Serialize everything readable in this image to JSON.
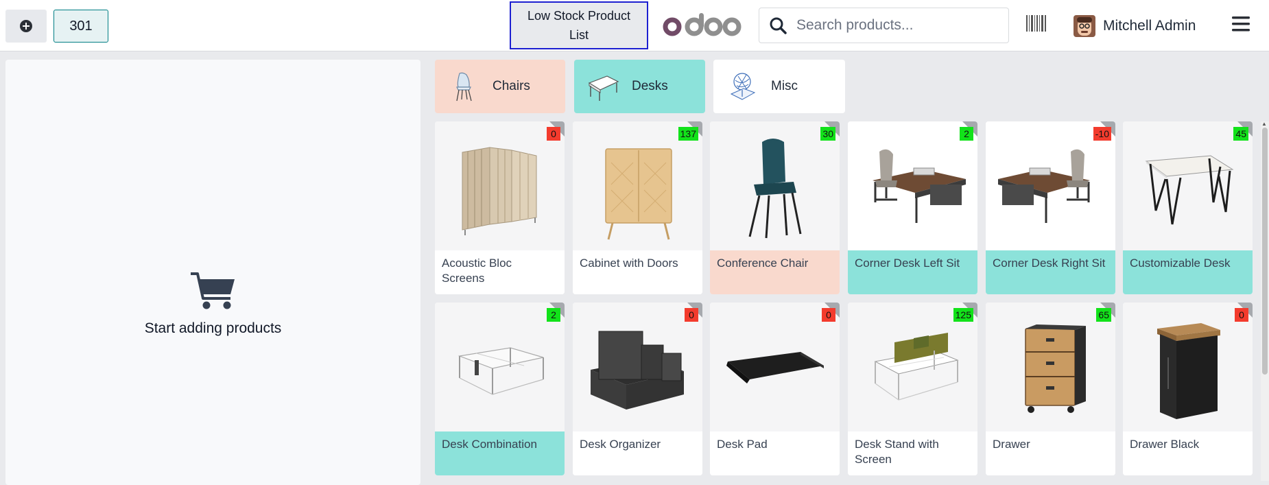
{
  "header": {
    "order_number": "301",
    "low_stock_label": "Low Stock Product List",
    "logo_text": "odoo",
    "search_placeholder": "Search products...",
    "user_name": "Mitchell Admin",
    "icons": [
      "plus-circle-icon",
      "search-icon",
      "barcode-icon",
      "avatar",
      "hamburger-menu-icon"
    ]
  },
  "order_panel": {
    "empty_message": "Start adding products",
    "icon": "shopping-cart-icon"
  },
  "categories": [
    {
      "label": "Chairs",
      "color": "#f9d9cd"
    },
    {
      "label": "Desks",
      "color": "#8ce2da"
    },
    {
      "label": "Misc",
      "color": "#ffffff"
    }
  ],
  "products": [
    {
      "name": "Acoustic Bloc Screens",
      "stock": "0",
      "status": "red",
      "category_color": "white"
    },
    {
      "name": "Cabinet with Doors",
      "stock": "137",
      "status": "green",
      "category_color": "white"
    },
    {
      "name": "Conference Chair",
      "stock": "30",
      "status": "green",
      "category_color": "pink"
    },
    {
      "name": "Corner Desk Left Sit",
      "stock": "2",
      "status": "green",
      "category_color": "teal"
    },
    {
      "name": "Corner Desk Right Sit",
      "stock": "-10",
      "status": "red",
      "category_color": "teal"
    },
    {
      "name": "Customizable Desk",
      "stock": "45",
      "status": "green",
      "category_color": "teal"
    },
    {
      "name": "Desk Combination",
      "stock": "2",
      "status": "green",
      "category_color": "teal"
    },
    {
      "name": "Desk Organizer",
      "stock": "0",
      "status": "red",
      "category_color": "white"
    },
    {
      "name": "Desk Pad",
      "stock": "0",
      "status": "red",
      "category_color": "white"
    },
    {
      "name": "Desk Stand with Screen",
      "stock": "125",
      "status": "green",
      "category_color": "white"
    },
    {
      "name": "Drawer",
      "stock": "65",
      "status": "green",
      "category_color": "white"
    },
    {
      "name": "Drawer Black",
      "stock": "0",
      "status": "red",
      "category_color": "white"
    }
  ],
  "colors": {
    "accent": "#017e84",
    "stock_ok": "#12e21a",
    "stock_low": "#f33b2d",
    "chairs": "#f9d9cd",
    "desks": "#8ce2da"
  }
}
